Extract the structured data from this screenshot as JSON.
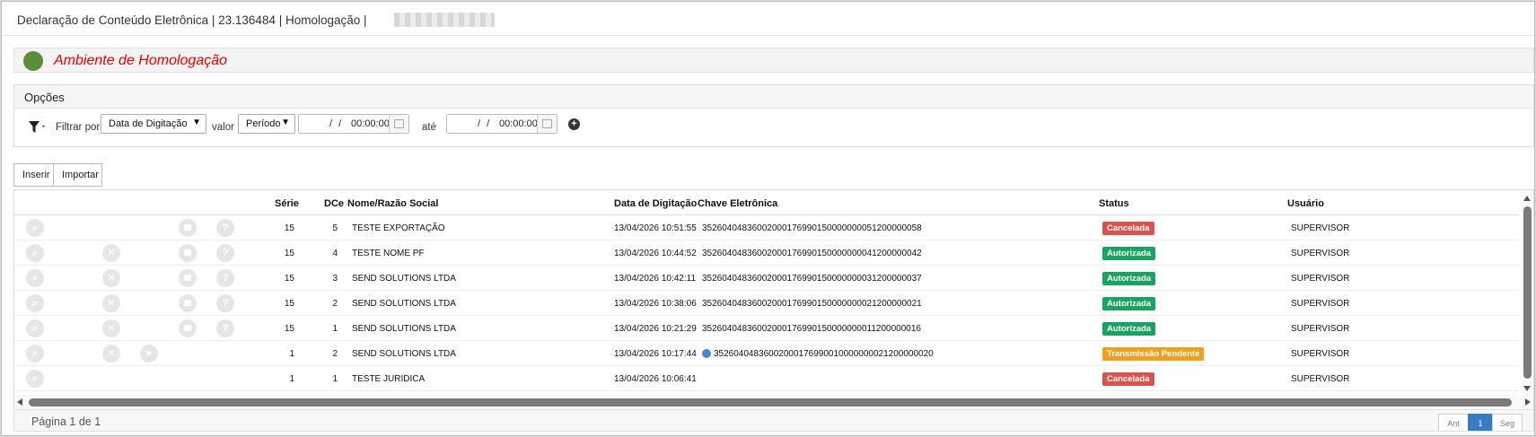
{
  "window": {
    "title": "Declaração de Conteúdo Eletrônica | 23.136484 | Homologação |"
  },
  "environment": {
    "label": "Ambiente de Homologação",
    "status_color": "#5b8c3a"
  },
  "options": {
    "title": "Opções",
    "filter_by_label": "Filtrar por",
    "filter_by_value": "Data de Digitação",
    "value_label": "valor",
    "value_value": "Período",
    "from_date": "/ /",
    "from_time": "00:00:00",
    "until_label": "até",
    "to_date": "/ /",
    "to_time": "00:00:00"
  },
  "toolbar": {
    "insert_label": "Inserir",
    "import_label": "Importar"
  },
  "table": {
    "headers": {
      "serie": "Série",
      "dce": "DCe",
      "nome": "Nome/Razão Social",
      "data": "Data de Digitação",
      "chave": "Chave Eletrônica",
      "status": "Status",
      "usuario": "Usuário"
    },
    "rows": [
      {
        "serie": "15",
        "dce": "5",
        "nome": "TESTE EXPORTAÇÃO",
        "data": "13/04/2026 10:51:55",
        "chave": "35260404836002000176990150000000051200000058",
        "status": "Cancelada",
        "usuario": "SUPERVISOR"
      },
      {
        "serie": "15",
        "dce": "4",
        "nome": "TESTE NOME PF",
        "data": "13/04/2026 10:44:52",
        "chave": "35260404836002000176990150000000041200000042",
        "status": "Autorizada",
        "usuario": "SUPERVISOR"
      },
      {
        "serie": "15",
        "dce": "3",
        "nome": "SEND SOLUTIONS LTDA",
        "data": "13/04/2026 10:42:11",
        "chave": "35260404836002000176990150000000031200000037",
        "status": "Autorizada",
        "usuario": "SUPERVISOR"
      },
      {
        "serie": "15",
        "dce": "2",
        "nome": "SEND SOLUTIONS LTDA",
        "data": "13/04/2026 10:38:06",
        "chave": "35260404836002000176990150000000021200000021",
        "status": "Autorizada",
        "usuario": "SUPERVISOR"
      },
      {
        "serie": "15",
        "dce": "1",
        "nome": "SEND SOLUTIONS LTDA",
        "data": "13/04/2026 10:21:29",
        "chave": "35260404836002000176990150000000011200000016",
        "status": "Autorizada",
        "usuario": "SUPERVISOR"
      },
      {
        "serie": "1",
        "dce": "2",
        "nome": "SEND SOLUTIONS LTDA",
        "data": "13/04/2026 10:17:44",
        "chave": "35260404836002000176990010000000021200000020",
        "status": "Transmissão Pendente",
        "usuario": "SUPERVISOR"
      },
      {
        "serie": "1",
        "dce": "1",
        "nome": "TESTE JURIDICA",
        "data": "13/04/2026 10:06:41",
        "chave": "",
        "status": "Cancelada",
        "usuario": "SUPERVISOR"
      }
    ]
  },
  "status_colors": {
    "Cancelada": "#d9534f",
    "Autorizada": "#1aa260",
    "Transmissão Pendente": "#f0a020"
  },
  "icons": {
    "view": "magnifier-icon",
    "cancel": "x-circle-icon",
    "print": "print-icon",
    "help": "question-icon",
    "send": "paper-plane-icon",
    "pending": "dot-icon",
    "filter": "filter-icon",
    "calendar": "calendar-icon",
    "add": "plus-circle-icon"
  },
  "footer": {
    "page_label": "Página 1 de 1",
    "prev_label": "Ant",
    "current_page": "1",
    "next_label": "Seg"
  }
}
